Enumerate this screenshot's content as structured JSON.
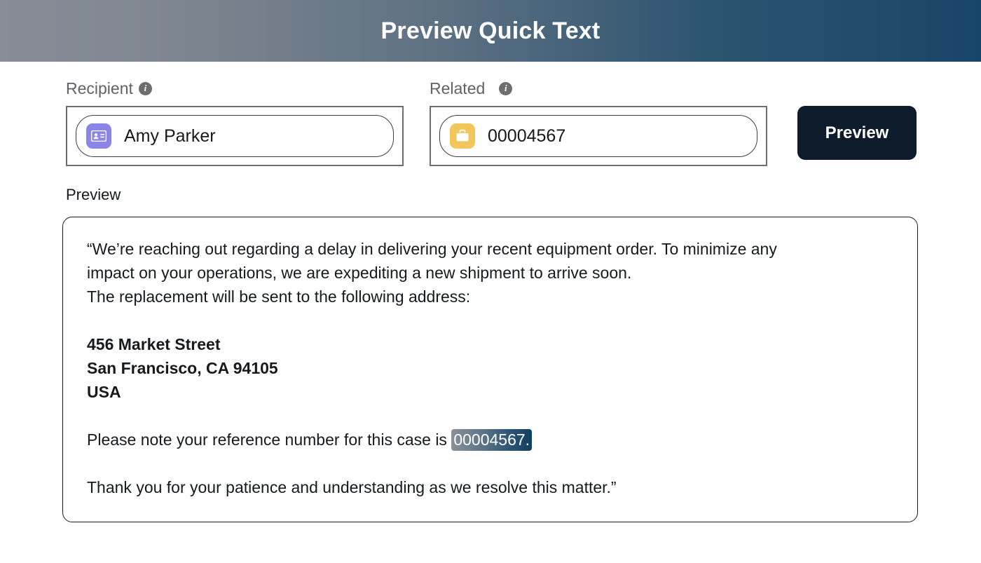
{
  "header": {
    "title": "Preview Quick Text",
    "gradient_from": "#868d95",
    "gradient_to": "#174569"
  },
  "fields": {
    "recipient": {
      "label": "Recipient",
      "info_glyph": "i",
      "icon_name": "contact-card-icon",
      "icon_color": "#8b85e8",
      "value": "Amy Parker"
    },
    "related": {
      "label": "Related",
      "info_glyph": "i",
      "icon_name": "case-briefcase-icon",
      "icon_color": "#f1c75c",
      "value": "00004567"
    }
  },
  "actions": {
    "preview_button": "Preview",
    "preview_button_color": "#0d1b2a"
  },
  "preview": {
    "heading": "Preview",
    "paragraph1_line1": "“We’re reaching out regarding a delay in delivering your recent equipment order. To minimize any",
    "paragraph1_line2": "impact on your operations, we are expediting a new shipment to arrive soon.",
    "paragraph1_line3": "The replacement will be sent to the following address:",
    "address_line1": "456 Market Street",
    "address_line2": "San Francisco, CA 94105",
    "address_line3": "USA",
    "reference_prefix": "Please note your reference number for this case is ",
    "reference_value": "00004567.",
    "closing": "Thank you for your patience and understanding as we resolve this matter.”"
  }
}
